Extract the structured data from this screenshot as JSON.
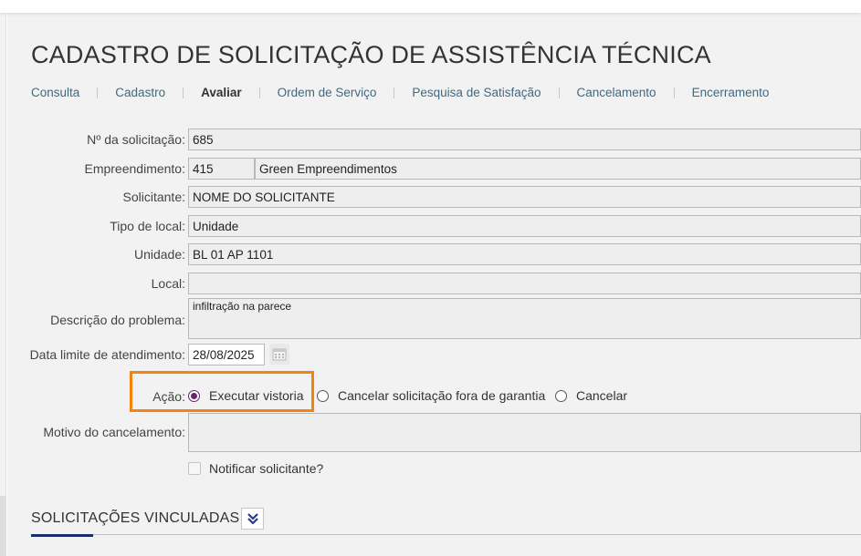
{
  "page": {
    "title": "CADASTRO DE SOLICITAÇÃO DE ASSISTÊNCIA TÉCNICA"
  },
  "nav": {
    "tabs": [
      {
        "label": "Consulta",
        "active": false
      },
      {
        "label": "Cadastro",
        "active": false
      },
      {
        "label": "Avaliar",
        "active": true
      },
      {
        "label": "Ordem de Serviço",
        "active": false
      },
      {
        "label": "Pesquisa de Satisfação",
        "active": false
      },
      {
        "label": "Cancelamento",
        "active": false
      },
      {
        "label": "Encerramento",
        "active": false
      }
    ]
  },
  "form": {
    "numero": {
      "label": "Nº da solicitação:",
      "value": "685"
    },
    "empreendimento": {
      "label": "Empreendimento:",
      "code": "415",
      "name": "Green Empreendimentos"
    },
    "solicitante": {
      "label": "Solicitante:",
      "value": "NOME DO SOLICITANTE"
    },
    "tipo_local": {
      "label": "Tipo de local:",
      "value": "Unidade"
    },
    "unidade": {
      "label": "Unidade:",
      "value": "BL 01 AP 1101"
    },
    "local": {
      "label": "Local:",
      "value": ""
    },
    "descricao": {
      "label": "Descrição do problema:",
      "value": "infiltração na parece"
    },
    "data_limite": {
      "label": "Data limite de atendimento:",
      "value": "28/08/2025",
      "icon": "calendar-icon"
    },
    "acao": {
      "label": "Ação:",
      "options": [
        {
          "label": "Executar vistoria",
          "selected": true
        },
        {
          "label": "Cancelar solicitação fora de garantia",
          "selected": false
        },
        {
          "label": "Cancelar",
          "selected": false
        }
      ],
      "highlight_color": "#f5830f"
    },
    "motivo": {
      "label": "Motivo do cancelamento:",
      "value": ""
    },
    "notificar": {
      "label": "Notificar solicitante?",
      "checked": false
    }
  },
  "section": {
    "title": "SOLICITAÇÕES VINCULADAS",
    "icon": "chevron-double-down-icon",
    "accent_color": "#1d2d6b"
  },
  "colors": {
    "link": "#3d6a84",
    "radio_selected": "#6b2370"
  }
}
